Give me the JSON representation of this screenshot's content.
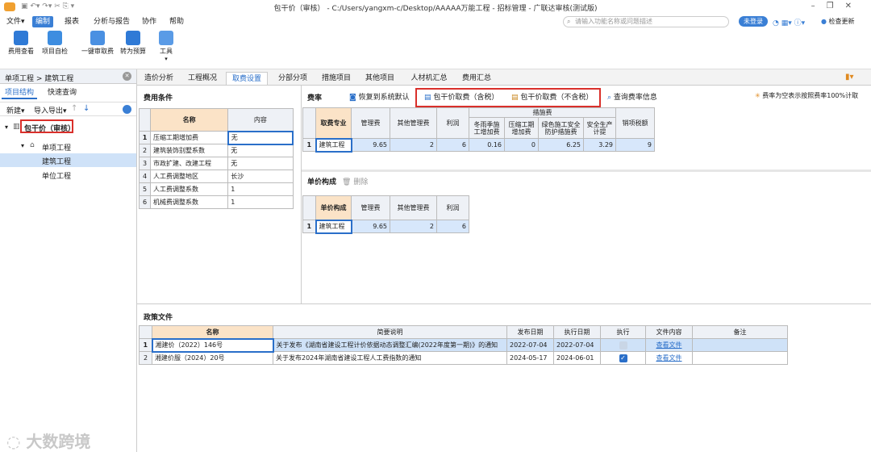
{
  "window": {
    "title": "包干价（审核） - C:/Users/yangxm-c/Desktop/AAAAA万能工程 - 招标管理 - 广联达审核(测试版)"
  },
  "menubar": {
    "file": "文件▾",
    "edit": "编制",
    "report": "报表",
    "analysis": "分析与报告",
    "collab": "协作",
    "help": "帮助",
    "search_placeholder": "请输入功能名称或问题描述",
    "login": "未登录",
    "update": "检查更新"
  },
  "ribbon": {
    "fee_view": "费用查看",
    "self_check": "项目自检",
    "one_key": "一键审取费",
    "to_budget": "转为预算",
    "tools": "工具"
  },
  "left": {
    "breadcrumb": "单项工程 > 建筑工程",
    "tab_structure": "项目结构",
    "tab_quick": "快速查询",
    "new": "新建▾",
    "import_export": "导入导出▾",
    "tree": {
      "root": "包干价（审核）",
      "single": "单项工程",
      "building": "建筑工程",
      "unit": "单位工程"
    }
  },
  "tabs": [
    "造价分析",
    "工程概况",
    "取费设置",
    "分部分项",
    "措施项目",
    "其他项目",
    "人材机汇总",
    "费用汇总"
  ],
  "fee_conditions": {
    "title": "费用条件",
    "col_name": "名称",
    "col_content": "内容",
    "rows": [
      {
        "n": "1",
        "name": "压缩工期增加费",
        "content": "无"
      },
      {
        "n": "2",
        "name": "建筑装饰别墅系数",
        "content": "无"
      },
      {
        "n": "3",
        "name": "市政扩建、改建工程",
        "content": "无"
      },
      {
        "n": "4",
        "name": "人工费调整地区",
        "content": "长沙"
      },
      {
        "n": "5",
        "name": "人工费调整系数",
        "content": "1"
      },
      {
        "n": "6",
        "name": "机械费调整系数",
        "content": "1"
      }
    ]
  },
  "rate": {
    "title": "费率",
    "restore": "恢复到系统默认",
    "incl_tax": "包干价取费（含税）",
    "excl_tax": "包干价取费（不含税）",
    "query": "查询费率信息",
    "note": "费率为空表示按照费率100%计取",
    "headers": {
      "major": "取费专业",
      "mgmt": "管理费",
      "other_mgmt": "其他管理费",
      "profit": "利润",
      "measures": "措施费",
      "winter": "冬雨季施工增加费",
      "compress": "压缩工期增加费",
      "green": "绿色施工安全防护措施费",
      "safety": "安全生产计提",
      "sales_tax": "销项税额"
    },
    "row": {
      "n": "1",
      "major": "建筑工程",
      "mgmt": "9.65",
      "other_mgmt": "2",
      "profit": "6",
      "winter": "0.16",
      "compress": "0",
      "green": "6.25",
      "safety": "3.29",
      "sales_tax": "9"
    }
  },
  "unit_price": {
    "title": "单价构成",
    "delete": "删除",
    "headers": {
      "comp": "单价构成",
      "mgmt": "管理费",
      "other_mgmt": "其他管理费",
      "profit": "利润"
    },
    "row": {
      "n": "1",
      "comp": "建筑工程",
      "mgmt": "9.65",
      "other_mgmt": "2",
      "profit": "6"
    }
  },
  "policy": {
    "title": "政策文件",
    "headers": {
      "name": "名称",
      "desc": "简要说明",
      "publish": "发布日期",
      "exec_date": "执行日期",
      "exec": "执行",
      "content": "文件内容",
      "remark": "备注"
    },
    "rows": [
      {
        "n": "1",
        "name": "湘建价（2022）146号",
        "desc": "关于发布《湖南省建设工程计价依据动态调整汇编(2022年度第一期)》的通知",
        "publish": "2022-07-04",
        "exec_date": "2022-07-04",
        "view": "查看文件"
      },
      {
        "n": "2",
        "name": "湘建价服（2024）20号",
        "desc": "关于发布2024年湖南省建设工程人工费指数的通知",
        "publish": "2024-05-17",
        "exec_date": "2024-06-01",
        "view": "查看文件"
      }
    ]
  },
  "watermark": "大数跨境",
  "colors": {
    "accent": "#2a6fc9",
    "highlight": "#d9302b"
  }
}
